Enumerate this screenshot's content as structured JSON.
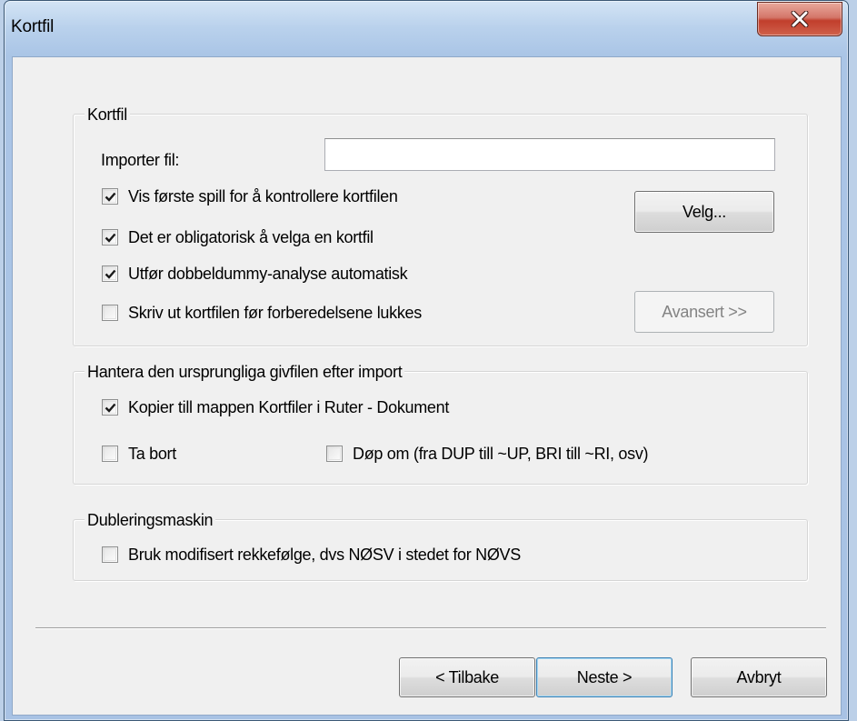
{
  "window": {
    "title": "Kortfil"
  },
  "kortfil_group": {
    "legend": "Kortfil",
    "import_label": "Importer fil:",
    "import_value": "",
    "checkboxes": [
      {
        "label": "Vis første spill for å kontrollere kortfilen",
        "checked": true
      },
      {
        "label": "Det er obligatorisk å velga en kortfil",
        "checked": true
      },
      {
        "label": "Utfør dobbeldummy-analyse automatisk",
        "checked": true
      },
      {
        "label": "Skriv ut kortfilen før forberedelsene lukkes",
        "checked": false
      }
    ],
    "choose_button": "Velg...",
    "advanced_button": "Avansert >>"
  },
  "original_file_group": {
    "legend": "Hantera den ursprungliga givfilen efter import",
    "copy_checkbox": {
      "label": "Kopier till mappen Kortfiler i Ruter - Dokument",
      "checked": true
    },
    "remove_checkbox": {
      "label": "Ta bort",
      "checked": false
    },
    "rename_checkbox": {
      "label": "Døp om (fra DUP till ~UP, BRI till ~RI, osv)",
      "checked": false
    }
  },
  "duplication_group": {
    "legend": "Dubleringsmaskin",
    "modified_order_checkbox": {
      "label": "Bruk modifisert rekkefølge, dvs NØSV i stedet for NØVS",
      "checked": false
    }
  },
  "footer": {
    "back_button": "< Tilbake",
    "next_button": "Neste >",
    "cancel_button": "Avbryt"
  },
  "colors": {
    "close_button": "#c13e2c",
    "dialog_background": "#f0f0f0",
    "frame": "#a8c2e4"
  },
  "icons": {
    "close": "close-x-icon",
    "check": "checkmark-icon"
  }
}
